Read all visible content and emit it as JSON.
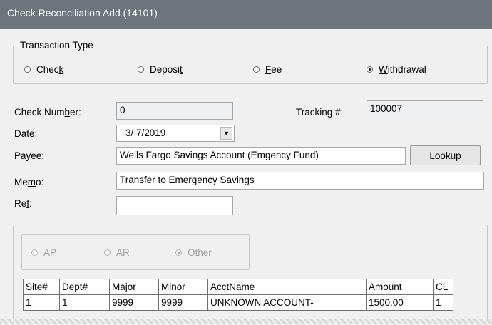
{
  "window": {
    "title": "Check Reconciliation Add (14101)"
  },
  "transaction_type": {
    "legend": "Transaction Type",
    "options": [
      {
        "pre": "Chec",
        "u": "k",
        "post": "",
        "selected": false
      },
      {
        "pre": "Deposi",
        "u": "t",
        "post": "",
        "selected": false
      },
      {
        "pre": "",
        "u": "F",
        "post": "ee",
        "selected": false
      },
      {
        "pre": "",
        "u": "W",
        "post": "ithdrawal",
        "selected": true
      }
    ]
  },
  "form": {
    "check_number": {
      "pre": "Check Num",
      "u": "b",
      "post": "er:",
      "value": "0"
    },
    "tracking": {
      "label": "Tracking #:",
      "value": "100007"
    },
    "date": {
      "pre": "Dat",
      "u": "e",
      "post": ":",
      "value": "3/  7/2019"
    },
    "payee": {
      "pre": "Pa",
      "u": "y",
      "post": "ee:",
      "value": "Wells Fargo Savings Account (Emgency Fund)"
    },
    "lookup_button": {
      "pre": "",
      "u": "L",
      "post": "ookup"
    },
    "memo": {
      "pre": "Me",
      "u": "m",
      "post": "o:",
      "value": "Transfer to Emergency Savings"
    },
    "ref": {
      "pre": "Re",
      "u": "f",
      "post": ":",
      "value": ""
    }
  },
  "account_type": {
    "options": [
      {
        "pre": "A",
        "u": "P",
        "post": "",
        "selected": false
      },
      {
        "pre": "A",
        "u": "R",
        "post": "",
        "selected": false
      },
      {
        "pre": "Ot",
        "u": "h",
        "post": "er",
        "selected": true
      }
    ]
  },
  "grid": {
    "columns": [
      "Site#",
      "Dept#",
      "Major",
      "Minor",
      "AcctName",
      "Amount",
      "CL"
    ],
    "rows": [
      [
        "1",
        "1",
        "9999",
        "9999",
        "UNKNOWN ACCOUNT-",
        "1500.00",
        "1"
      ]
    ]
  }
}
